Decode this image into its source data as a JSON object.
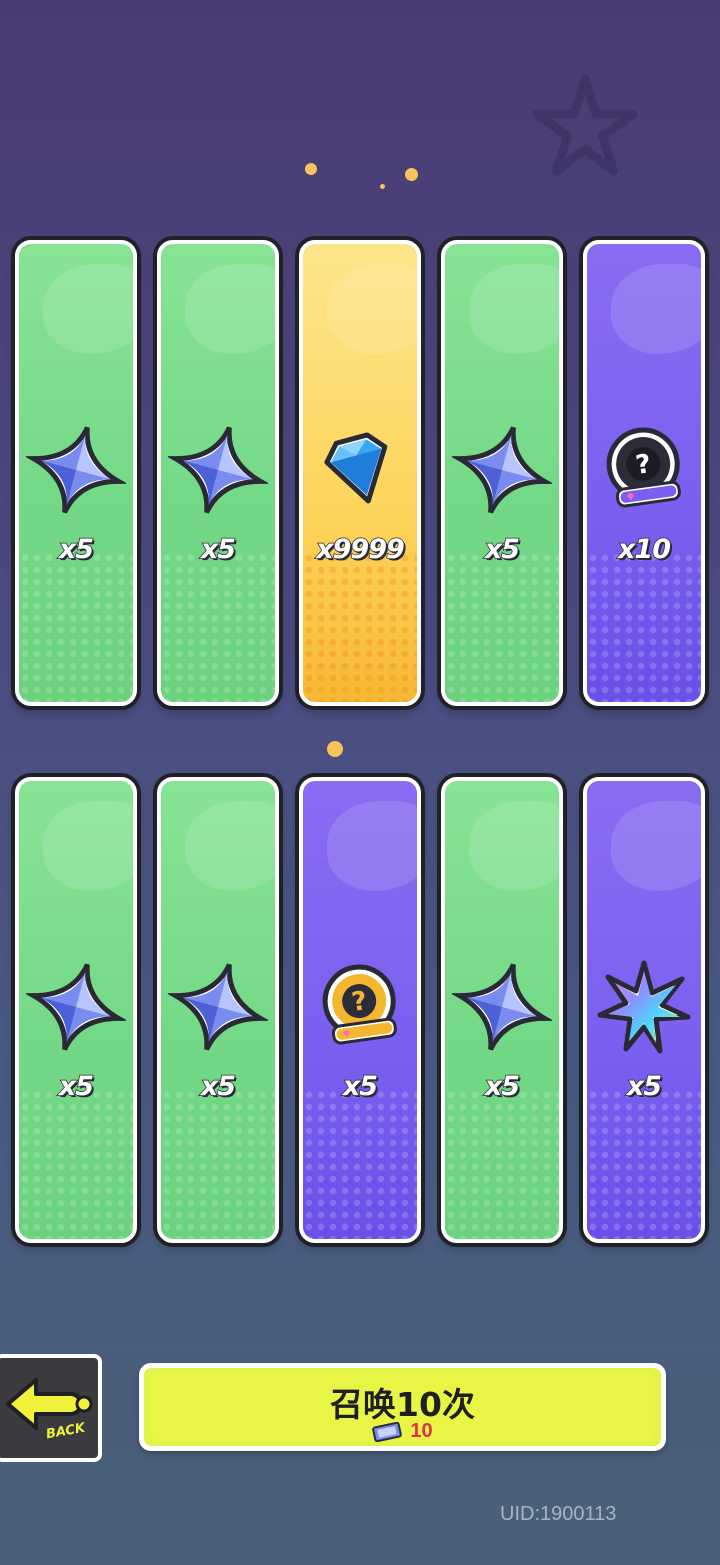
{
  "summon": {
    "label": "召唤10次",
    "cost": "10",
    "ticket_icon": "summon-ticket-icon"
  },
  "back": {
    "label": "BACK",
    "icon": "arrow-left-icon"
  },
  "uid": "UID:1900113",
  "colors": {
    "green": "#74d987",
    "gold": "#fcd45a",
    "purple": "#7a5ff0",
    "button": "#e8f545"
  },
  "rewards_row1": [
    {
      "rarity": "green",
      "icon": "star-shard-icon",
      "qty": "x5"
    },
    {
      "rarity": "green",
      "icon": "star-shard-icon",
      "qty": "x5"
    },
    {
      "rarity": "gold",
      "icon": "diamond-gem-icon",
      "qty": "x9999"
    },
    {
      "rarity": "green",
      "icon": "star-shard-icon",
      "qty": "x5"
    },
    {
      "rarity": "purple",
      "icon": "mystery-deity-badge-icon",
      "qty": "x10"
    }
  ],
  "rewards_row2": [
    {
      "rarity": "green",
      "icon": "star-shard-icon",
      "qty": "x5"
    },
    {
      "rarity": "green",
      "icon": "star-shard-icon",
      "qty": "x5"
    },
    {
      "rarity": "purple",
      "icon": "mystery-deity-badge-gold-icon",
      "qty": "x5"
    },
    {
      "rarity": "green",
      "icon": "star-shard-icon",
      "qty": "x5"
    },
    {
      "rarity": "purple",
      "icon": "rainbow-crystal-icon",
      "qty": "x5"
    }
  ]
}
